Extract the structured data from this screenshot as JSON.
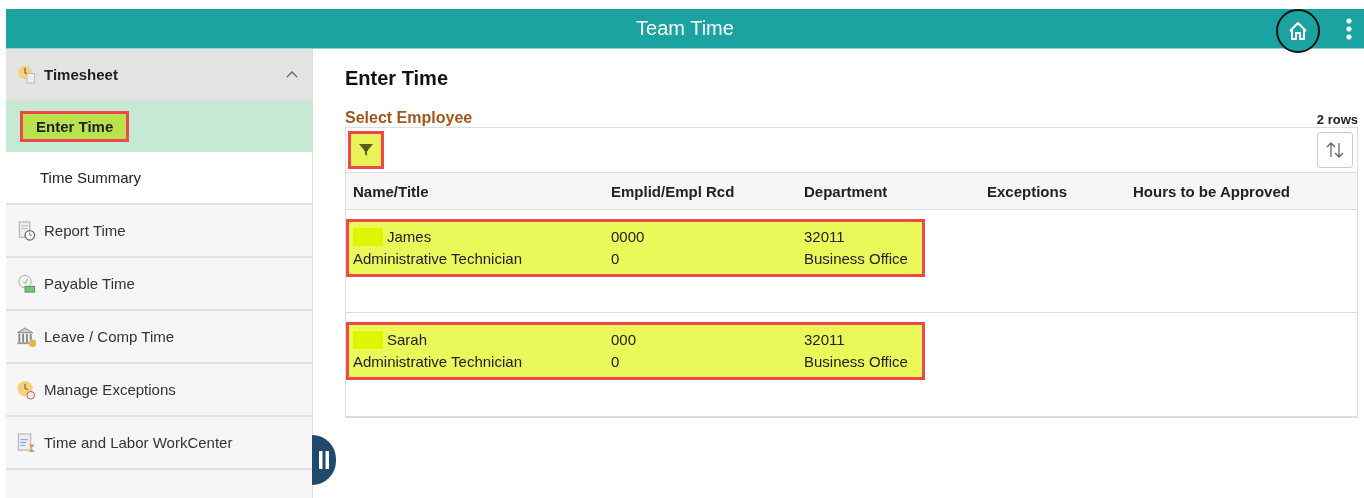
{
  "header": {
    "title": "Team Time"
  },
  "sidebar": {
    "items": [
      {
        "label": "Timesheet",
        "expanded": true,
        "children": [
          {
            "label": "Enter Time",
            "selected": true,
            "highlighted": true
          },
          {
            "label": "Time Summary",
            "selected": false,
            "highlighted": false
          }
        ]
      },
      {
        "label": "Report Time",
        "selected": false
      },
      {
        "label": "Payable Time",
        "selected": false
      },
      {
        "label": "Leave / Comp Time",
        "selected": false
      },
      {
        "label": "Manage Exceptions",
        "selected": false
      },
      {
        "label": "Time and Labor WorkCenter",
        "selected": false
      }
    ]
  },
  "page_title": "Enter Time",
  "section_title": "Select Employee",
  "row_count": "2 rows",
  "filter_highlighted": true,
  "table": {
    "columns": [
      "Name/Title",
      "Emplid/Empl Rcd",
      "Department",
      "Exceptions",
      "Hours to be Approved"
    ],
    "rows": [
      {
        "name": "James",
        "title": "Administrative Technician",
        "emplid": "0000",
        "empl_rcd": "0",
        "dept_id": "32011",
        "dept_name": "Business Office",
        "highlighted": true
      },
      {
        "name": "Sarah",
        "title": "Administrative Technician",
        "emplid": "000",
        "empl_rcd": "0",
        "dept_id": "32011",
        "dept_name": "Business Office",
        "highlighted": true
      }
    ]
  }
}
